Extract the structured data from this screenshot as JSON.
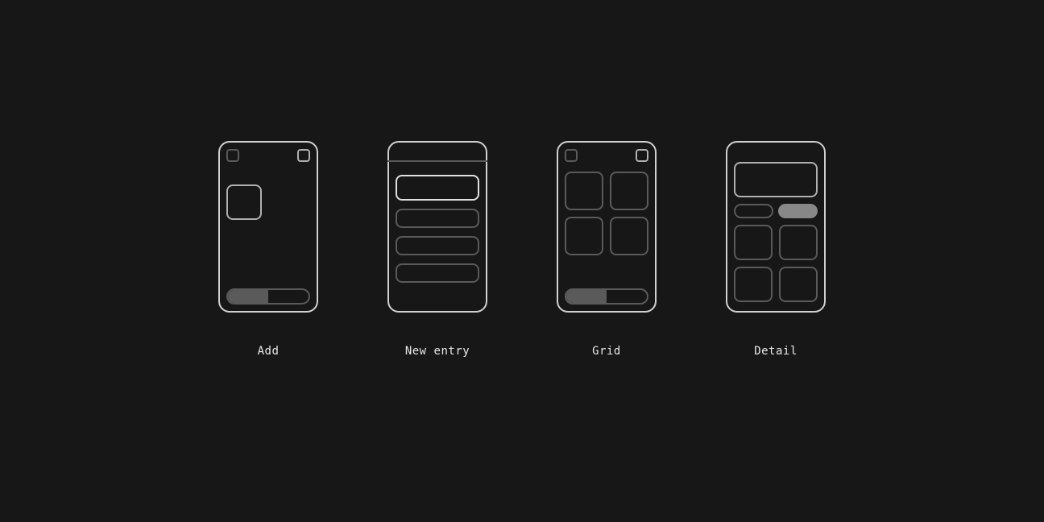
{
  "wireframes": [
    {
      "key": "add",
      "label": "Add"
    },
    {
      "key": "newentry",
      "label": "New entry"
    },
    {
      "key": "grid",
      "label": "Grid"
    },
    {
      "key": "detail",
      "label": "Detail"
    }
  ],
  "colors": {
    "background": "#171717",
    "stroke_bright": "#d0d0d0",
    "stroke_dim": "#5a5a5a",
    "fill_mid": "#888"
  }
}
